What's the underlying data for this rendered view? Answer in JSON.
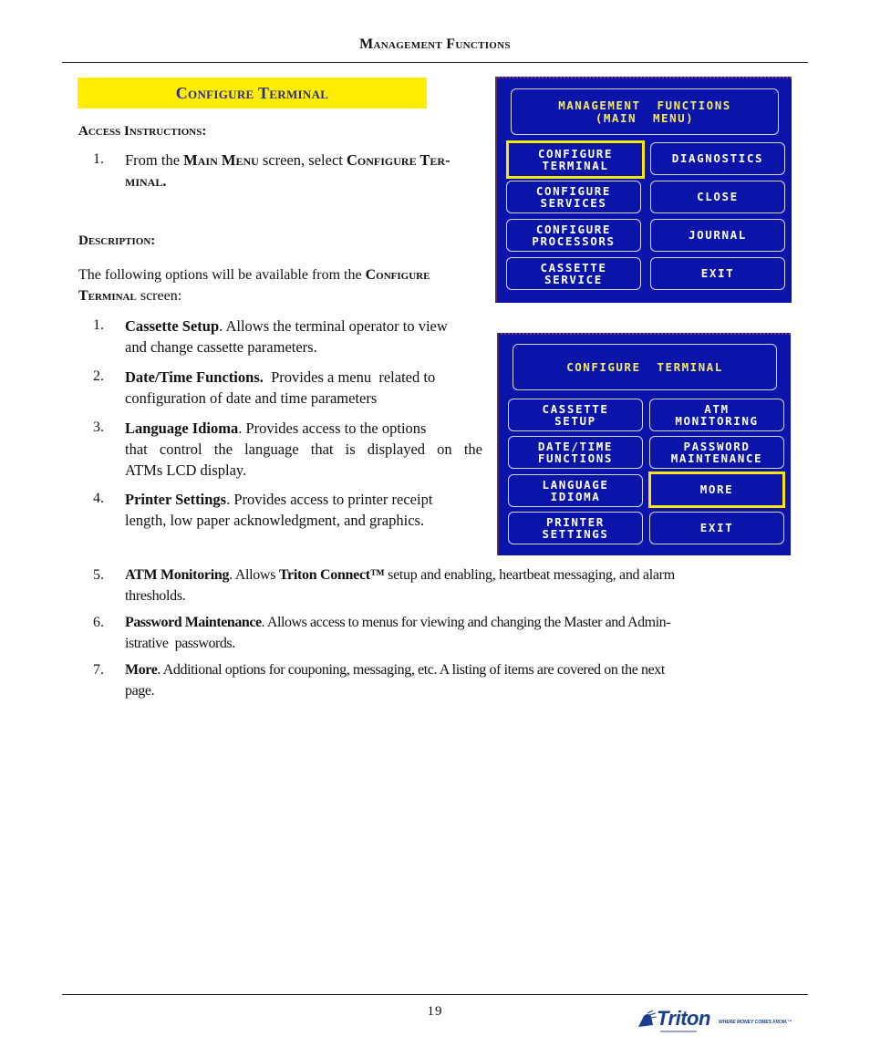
{
  "header": {
    "running_title": "Management Functions"
  },
  "section": {
    "title": "Configure Terminal",
    "banner_color": "#ffee00",
    "title_color": "#2b2f86"
  },
  "access": {
    "heading": "Access Instructions:",
    "step_number": "1.",
    "step_prefix": "From the ",
    "step_menu": "Main Menu",
    "step_middle": " screen, select ",
    "step_target_line1": "Configure Ter-",
    "step_target_line2": "minal",
    "step_suffix": "."
  },
  "description": {
    "heading": "Description:",
    "intro_prefix": "The following options will be available from the ",
    "intro_target_line1": "Configure",
    "intro_target_line2": "Terminal",
    "intro_suffix": " screen:"
  },
  "options": [
    {
      "num": "1.",
      "title": "Cassette Setup",
      "text_line1": ". Allows the terminal operator to view",
      "text_line2": "and change cassette parameters."
    },
    {
      "num": "2.",
      "title": "Date/Time Functions.",
      "text_line1": "  Provides a menu  related to",
      "text_line2": "configuration of date and time parameters"
    },
    {
      "num": "3.",
      "title": "Language Idioma",
      "text_line1": ". Provides access to the options",
      "text_line2": "that control the language that is displayed on the",
      "text_line3": "ATMs LCD display."
    },
    {
      "num": "4.",
      "title": "Printer Settings",
      "text_line1": ". Provides access to printer receipt",
      "text_line2": "length, low paper acknowledgment, and graphics."
    },
    {
      "num": "5.",
      "title": "ATM Monitoring",
      "text_mid": ". Allows ",
      "title2": "Triton Connect™",
      "text_line1": " setup and enabling, heartbeat messaging, and alarm",
      "text_line2": "thresholds."
    },
    {
      "num": "6.",
      "title": "Password Maintenance",
      "text_line1": ". Allows access to menus for viewing and changing the Master and Admin-",
      "text_line2": "istrative  passwords."
    },
    {
      "num": "7.",
      "title": "More",
      "text_line1": ". Additional options for couponing, messaging, etc. A listing of items are covered on the next",
      "text_line2": "page."
    }
  ],
  "screen_main_menu": {
    "title_line1": "MANAGEMENT  FUNCTIONS",
    "title_line2": "(MAIN  MENU)",
    "left_buttons": [
      "CONFIGURE\nTERMINAL",
      "CONFIGURE\nSERVICES",
      "CONFIGURE\nPROCESSORS",
      "CASSETTE\nSERVICE"
    ],
    "right_buttons": [
      "DIAGNOSTICS",
      "CLOSE",
      "JOURNAL",
      "EXIT"
    ],
    "selected": "CONFIGURE TERMINAL"
  },
  "screen_configure_terminal": {
    "title": "CONFIGURE  TERMINAL",
    "left_buttons": [
      "CASSETTE\nSETUP",
      "DATE/TIME\nFUNCTIONS",
      "LANGUAGE\nIDIOMA",
      "PRINTER\nSETTINGS"
    ],
    "right_buttons": [
      "ATM\nMONITORING",
      "PASSWORD\nMAINTENANCE",
      "MORE",
      "EXIT"
    ],
    "selected": "MORE"
  },
  "colors": {
    "screen_bg": "#0a14a8",
    "screen_title_text": "#f3e86a",
    "selection_border": "#ffe800"
  },
  "footer": {
    "page_number": "19",
    "logo_word": "Triton",
    "logo_tagline": "WHERE MONEY COMES FROM.™"
  }
}
